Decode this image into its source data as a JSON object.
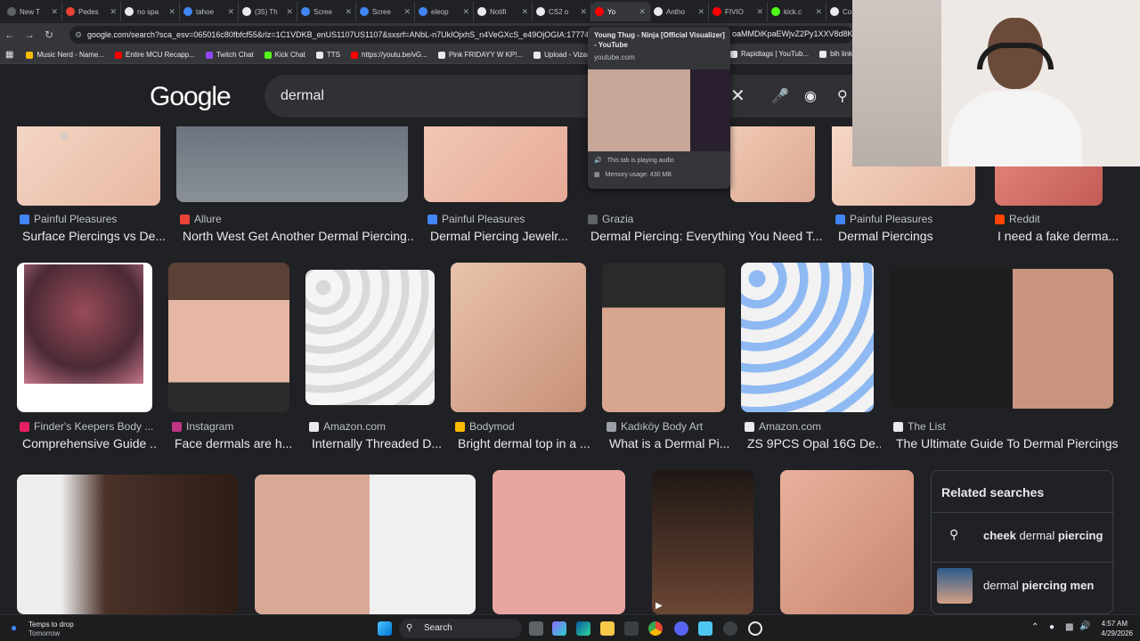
{
  "browser": {
    "tabs": [
      {
        "label": "New T",
        "color": "#5f6368"
      },
      {
        "label": "Pedes",
        "color": "#ea4335"
      },
      {
        "label": "no spa",
        "color": "#e8eaed"
      },
      {
        "label": "tahoe",
        "color": "#4285f4"
      },
      {
        "label": "(35) Th",
        "color": "#e8eaed"
      },
      {
        "label": "Scree",
        "color": "#4285f4"
      },
      {
        "label": "Scree",
        "color": "#4285f4"
      },
      {
        "label": "eleop",
        "color": "#4285f4"
      },
      {
        "label": "Notifi",
        "color": "#e8eaed"
      },
      {
        "label": "CS2 o",
        "color": "#e8eaed"
      },
      {
        "label": "Yo",
        "color": "#ff0000"
      },
      {
        "label": "Antho",
        "color": "#e8eaed"
      },
      {
        "label": "FIVIO",
        "color": "#ff0000"
      },
      {
        "label": "kick.c",
        "color": "#53fc18"
      },
      {
        "label": "Co",
        "color": "#e8eaed"
      }
    ],
    "url": "google.com/search?sca_esv=065016c80fbfcf55&rlz=1C1VDKB_enUS1107US1107&sxsrf=ANbL-n7UkIOjxhS_n4VeGXcS_e49OjOGIA:1777453023099",
    "url_tail": "oaMMDiKpaEWjvZ2Py1XXV8d8KvIL",
    "bookmarks": [
      {
        "label": "Music Nerd - Name...",
        "color": "#fbbc04"
      },
      {
        "label": "Entire MCU Recapp...",
        "color": "#ff0000"
      },
      {
        "label": "Twitch Chat",
        "color": "#9146ff"
      },
      {
        "label": "Kick Chat",
        "color": "#53fc18"
      },
      {
        "label": "TTS",
        "color": "#e8eaed"
      },
      {
        "label": "https://youtu.be/vG...",
        "color": "#ff0000"
      },
      {
        "label": "Pink FRIDAYY W KP!...",
        "color": "#e8eaed"
      },
      {
        "label": "Upload - Vizard",
        "color": "#e8eaed"
      }
    ],
    "bookmarks_right": [
      {
        "label": "Rapidtags | YouTub...",
        "color": "#e8eaed"
      },
      {
        "label": "bih links",
        "color": "#e8eaed"
      }
    ]
  },
  "google": {
    "logo": "Google",
    "query": "dermal"
  },
  "row1": [
    {
      "source": "Painful Pleasures",
      "title": "Surface Piercings vs De...",
      "color": "#4285f4"
    },
    {
      "source": "Allure",
      "title": "North West Get Another Dermal Piercing...",
      "color": "#ea4335"
    },
    {
      "source": "Painful Pleasures",
      "title": "Dermal Piercing Jewelr...",
      "color": "#4285f4"
    },
    {
      "source": "Grazia",
      "title": "Dermal Piercing: Everything You Need T...",
      "color": "#5f6368"
    },
    {
      "source": "Painful Pleasures",
      "title": "Dermal Piercings",
      "color": "#4285f4"
    },
    {
      "source": "Reddit",
      "title": "I need a fake derma...",
      "color": "#ff4500"
    }
  ],
  "row2": [
    {
      "source": "Finder's Keepers Body ...",
      "title": "Comprehensive Guide ...",
      "color": "#e91e63"
    },
    {
      "source": "Instagram",
      "title": "Face dermals are h...",
      "color": "#c13584"
    },
    {
      "source": "Amazon.com",
      "title": "Internally Threaded D...",
      "color": "#e8eaed"
    },
    {
      "source": "Bodymod",
      "title": "Bright dermal top in a ...",
      "color": "#fbbc04"
    },
    {
      "source": "Kadıköy Body Art",
      "title": "What is a Dermal Pi...",
      "color": "#9aa0a6"
    },
    {
      "source": "Amazon.com",
      "title": "ZS 9PCS Opal 16G De...",
      "color": "#e8eaed"
    },
    {
      "source": "The List",
      "title": "The Ultimate Guide To Dermal Piercings",
      "color": "#e8eaed"
    }
  ],
  "related": {
    "heading": "Related searches",
    "items": [
      {
        "bold": "cheek",
        "rest": " dermal ",
        "bold2": "piercing"
      },
      {
        "bold": "",
        "rest": "dermal ",
        "bold2": "piercing men"
      }
    ]
  },
  "hovercard": {
    "title": "Young Thug - Ninja [Official Visualizer] - YouTube",
    "domain": "youtube.com",
    "audio": "This tab is playing audio",
    "memory": "Memory usage: 430 MB"
  },
  "taskbar": {
    "weather_title": "Temps to drop",
    "weather_sub": "Tomorrow",
    "search_label": "Search",
    "time": "4:57 AM",
    "date": "4/29/2026"
  }
}
